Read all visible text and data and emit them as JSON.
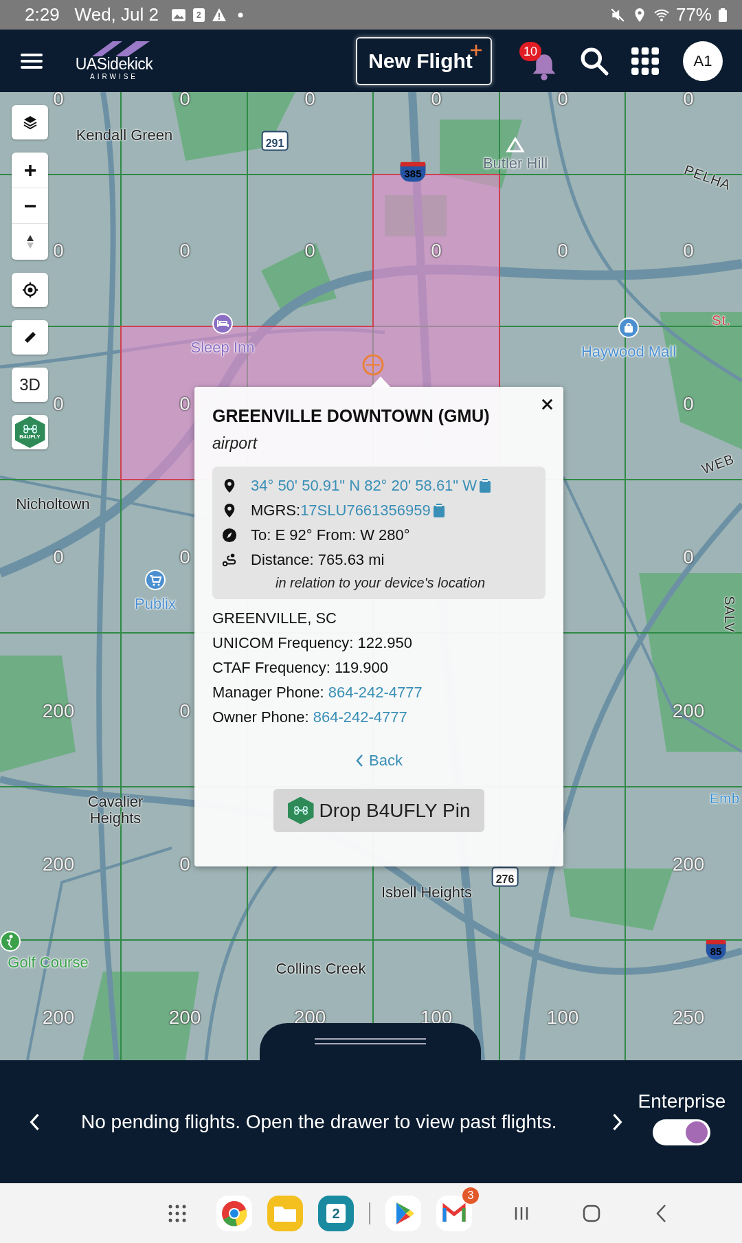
{
  "status_bar": {
    "time": "2:29",
    "date": "Wed, Jul 2",
    "calendar_date": "2",
    "battery": "77%"
  },
  "header": {
    "logo_text": "UASidekick",
    "logo_subtext": "AIRWISE",
    "new_flight_button": "New Flight",
    "notification_count": "10",
    "avatar": "A1"
  },
  "map_controls": {
    "three_d_button": "3D",
    "b4ufly_badge": "B4UFLY"
  },
  "map": {
    "grid_labels": [
      {
        "cells": [
          "0",
          "0",
          "0",
          "0",
          "0",
          "0"
        ]
      },
      {
        "cells": [
          "0",
          "0",
          "0",
          "0",
          "0",
          "0"
        ]
      },
      {
        "cells": [
          "0",
          "0"
        ],
        "right_cells": [
          "0"
        ]
      },
      {
        "cells": [
          "0",
          "0"
        ],
        "right_cells": [
          "0"
        ]
      },
      {
        "cells": [
          "200",
          "0"
        ],
        "right_cells": [
          "200"
        ]
      },
      {
        "cells": [
          "200",
          "0"
        ],
        "right_cells": [
          "200"
        ]
      },
      {
        "cells": [
          "200",
          "200",
          "200",
          "100",
          "100",
          "250"
        ]
      }
    ],
    "places": [
      {
        "text": "Kendall Green",
        "kind": "place",
        "color": "#1f1f1f"
      },
      {
        "text": "291",
        "kind": "shield",
        "color": "#2a4a6a"
      },
      {
        "text": "Butler Hill",
        "kind": "poi",
        "color": "#5f6e7c"
      },
      {
        "text": "385",
        "kind": "interstate",
        "color": "#2554a4"
      },
      {
        "text": "PELHA",
        "kind": "edge",
        "color": "#2a2a2a"
      },
      {
        "text": "St.",
        "kind": "edge",
        "color": "#d0404a"
      },
      {
        "text": "Sleep Inn",
        "kind": "poi",
        "color": "#8b6fc4"
      },
      {
        "text": "Haywood Mall",
        "kind": "poi",
        "color": "#4b8fd0"
      },
      {
        "text": "WEB",
        "kind": "edge",
        "color": "#2a2a2a"
      },
      {
        "text": "Nicholtown",
        "kind": "place",
        "color": "#1f1f1f"
      },
      {
        "text": "Publix",
        "kind": "poi",
        "color": "#4b8fd0"
      },
      {
        "text": "SALV",
        "kind": "edge",
        "color": "#2a2a2a"
      },
      {
        "text": "Cavalier Heights",
        "kind": "place",
        "color": "#1f1f1f"
      },
      {
        "text": "Emb",
        "kind": "edge",
        "color": "#3a8fd0"
      },
      {
        "text": "276",
        "kind": "shield",
        "color": "#2a2a2a"
      },
      {
        "text": "Isbell Heights",
        "kind": "place",
        "color": "#1f1f1f"
      },
      {
        "text": "85",
        "kind": "interstate",
        "color": "#2554a4"
      },
      {
        "text": "Golf Course",
        "kind": "poi",
        "color": "#3aa04a"
      },
      {
        "text": "Collins Creek",
        "kind": "place",
        "color": "#1f1f1f"
      }
    ]
  },
  "popup": {
    "title": "GREENVILLE DOWNTOWN (GMU)",
    "subtitle": "airport",
    "info_rows": [
      {
        "kind": "pin",
        "value": "34° 50' 50.91\" N 82° 20' 58.61\" W"
      },
      {
        "kind": "pin",
        "label": "MGRS: ",
        "value": "17SLU7661356959"
      },
      {
        "kind": "compass",
        "label": "To: E 92° From: W 280°"
      },
      {
        "kind": "distance",
        "label": "Distance: 765.63 mi"
      }
    ],
    "info_note": "in relation to your device's location",
    "details": [
      {
        "label": "GREENVILLE, SC"
      },
      {
        "label": "UNICOM Frequency: 122.950"
      },
      {
        "label": "CTAF Frequency: 119.900"
      },
      {
        "label": "Manager Phone: ",
        "link": "864-242-4777"
      },
      {
        "label": "Owner Phone: ",
        "link": "864-242-4777"
      }
    ],
    "back_link": "Back",
    "drop_pin_button": "Drop B4UFLY Pin"
  },
  "bottom_bar": {
    "message": "No pending flights. Open the drawer to view past flights.",
    "toggle": {
      "label": "Enterprise",
      "on": true
    }
  },
  "nav_bar": {
    "calendar_date": "2",
    "gmail_badge": "3"
  }
}
